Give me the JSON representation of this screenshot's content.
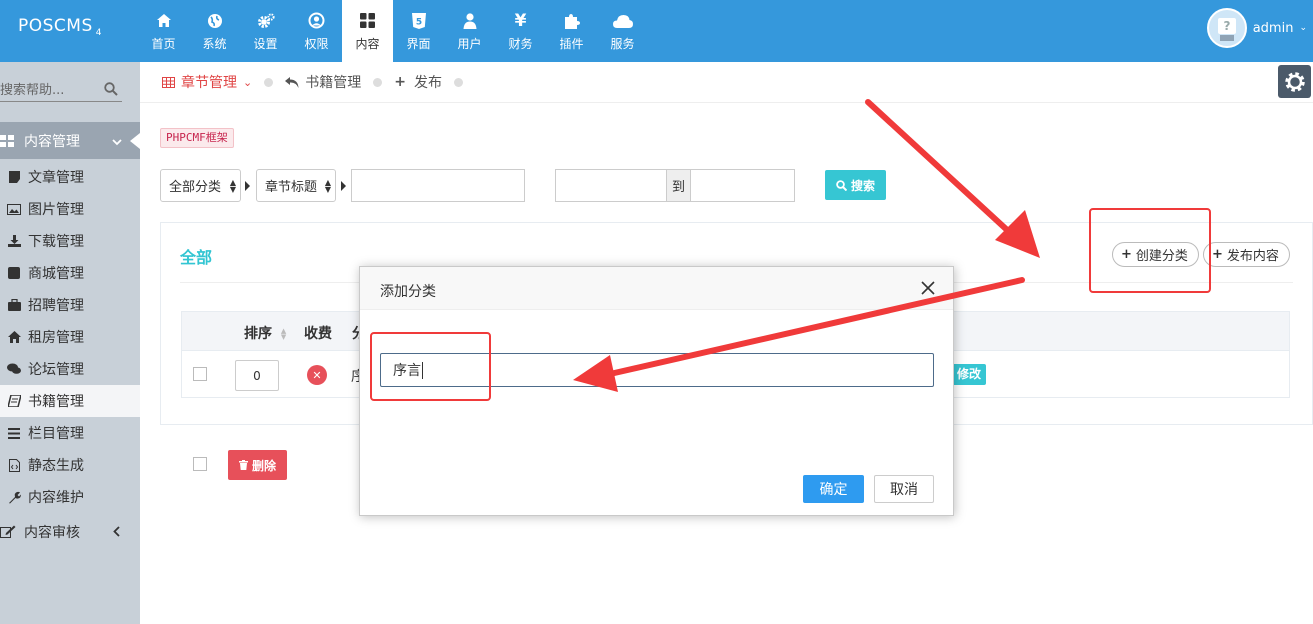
{
  "app": {
    "logo": "POSCMS",
    "logo_sub": "4"
  },
  "nav": [
    {
      "label": "首页",
      "icon": "home-icon"
    },
    {
      "label": "系统",
      "icon": "globe-icon"
    },
    {
      "label": "设置",
      "icon": "cogs-icon"
    },
    {
      "label": "权限",
      "icon": "user-circle-icon"
    },
    {
      "label": "内容",
      "icon": "grid-icon",
      "active": true
    },
    {
      "label": "界面",
      "icon": "html5-icon"
    },
    {
      "label": "用户",
      "icon": "user-icon"
    },
    {
      "label": "财务",
      "icon": "yen-icon"
    },
    {
      "label": "插件",
      "icon": "puzzle-icon"
    },
    {
      "label": "服务",
      "icon": "cloud-icon"
    }
  ],
  "user": {
    "name": "admin"
  },
  "sidebar": {
    "search_placeholder": "搜索帮助...",
    "group": "内容管理",
    "items": [
      {
        "label": "文章管理",
        "icon": "file-icon"
      },
      {
        "label": "图片管理",
        "icon": "picture-icon"
      },
      {
        "label": "下载管理",
        "icon": "download-icon"
      },
      {
        "label": "商城管理",
        "icon": "square-icon"
      },
      {
        "label": "招聘管理",
        "icon": "briefcase-icon"
      },
      {
        "label": "租房管理",
        "icon": "home-icon"
      },
      {
        "label": "论坛管理",
        "icon": "comments-icon"
      },
      {
        "label": "书籍管理",
        "icon": "book-icon",
        "active": true
      },
      {
        "label": "栏目管理",
        "icon": "list-icon"
      },
      {
        "label": "静态生成",
        "icon": "file-code-icon"
      },
      {
        "label": "内容维护",
        "icon": "wrench-icon"
      }
    ],
    "audit": "内容审核"
  },
  "breadcrumb": {
    "current": "章节管理",
    "back": "书籍管理",
    "publish": "发布"
  },
  "tag": "PHPCMF框架",
  "filters": {
    "category": "全部分类",
    "field": "章节标题",
    "to": "到",
    "search": "搜索"
  },
  "panel": {
    "title": "全部",
    "create_category": "创建分类",
    "publish_content": "发布内容",
    "columns": [
      "排序",
      "收费",
      "分"
    ],
    "row": {
      "order": "0",
      "title_prefix": "序",
      "edit": "修改"
    },
    "delete": "删除"
  },
  "modal": {
    "title": "添加分类",
    "input_value": "序言",
    "ok": "确定",
    "cancel": "取消"
  },
  "colors": {
    "topbar": "#3598dc",
    "accent": "#36c6d3",
    "danger": "#e7505a",
    "annotation": "#f03a3a"
  }
}
